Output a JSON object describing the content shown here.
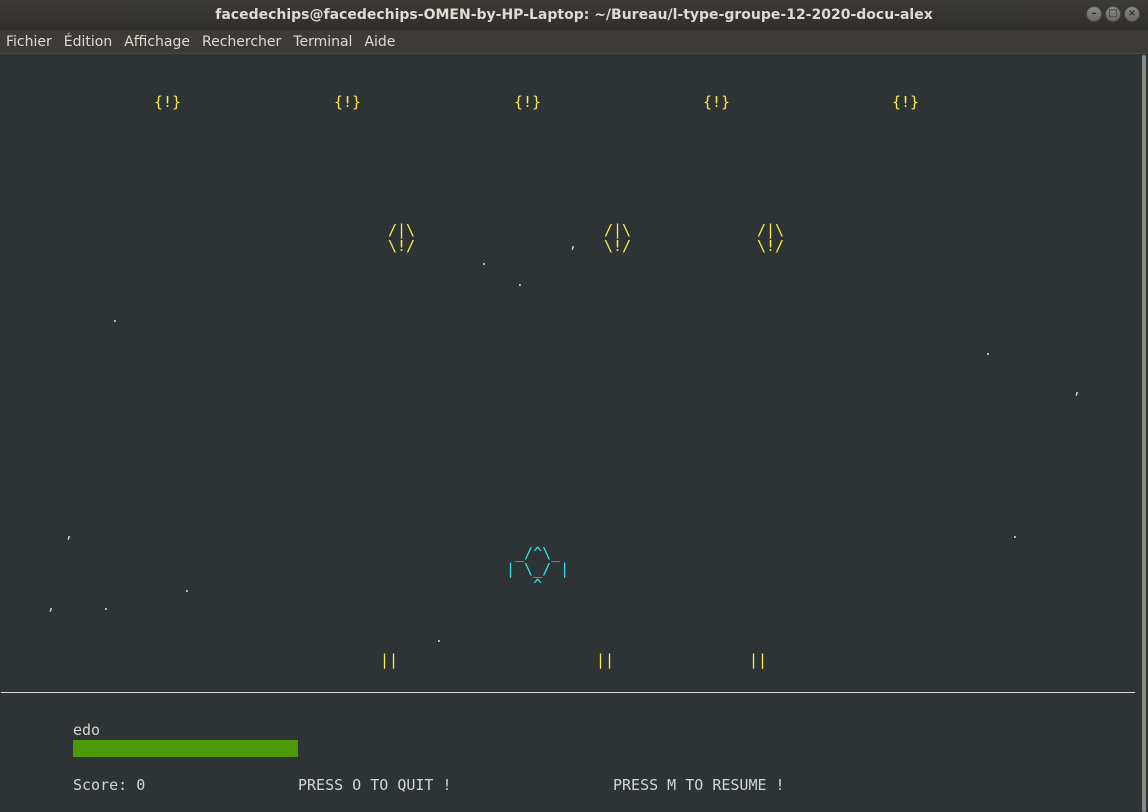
{
  "window": {
    "title": "facedechips@facedechips-OMEN-by-HP-Laptop: ~/Bureau/l-type-groupe-12-2020-docu-alex",
    "buttons": [
      "–",
      "□",
      "×"
    ]
  },
  "menubar": {
    "items": [
      "Fichier",
      "Édition",
      "Affichage",
      "Rechercher",
      "Terminal",
      "Aide"
    ]
  },
  "game": {
    "enemy_small": "{!}",
    "enemy_large": "/|\\\n\\!/",
    "enemy_bullet": "||",
    "player_ship": " _/^\\_\n| \\_/ |\n   ^",
    "star_chars": [
      ".",
      ","
    ],
    "player_name": "edo",
    "health_fraction": 1.0,
    "score_text": "Score: 0",
    "quit_text": "PRESS O TO QUIT !",
    "resume_text": "PRESS M TO RESUME !"
  },
  "colors": {
    "enemy": "#fce94f",
    "player": "#34e2e2",
    "health": "#4e9a06",
    "background": "#2e3436"
  }
}
